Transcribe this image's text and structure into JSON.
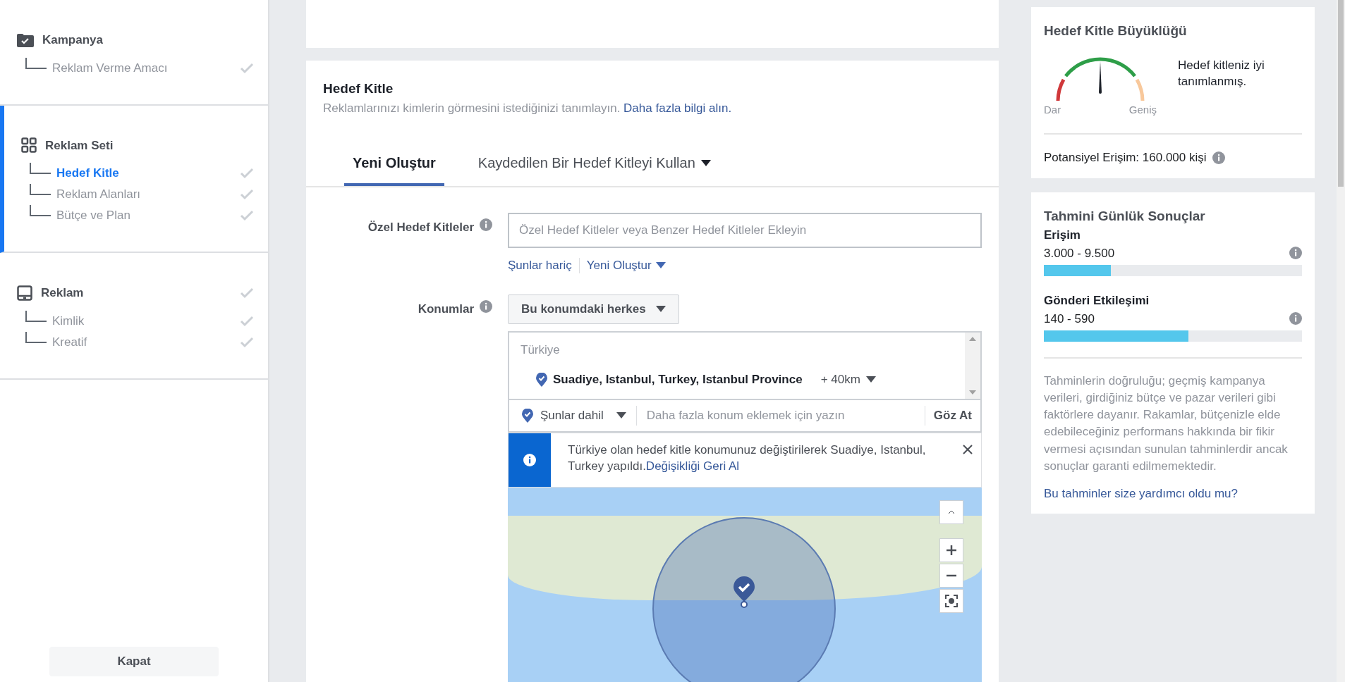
{
  "sidebar": {
    "sections": [
      {
        "title": "Kampanya",
        "active": false,
        "done": false,
        "items": [
          {
            "label": "Reklam Verme Amacı",
            "selected": false,
            "done": true
          }
        ]
      },
      {
        "title": "Reklam Seti",
        "active": true,
        "done": false,
        "items": [
          {
            "label": "Hedef Kitle",
            "selected": true,
            "done": true
          },
          {
            "label": "Reklam Alanları",
            "selected": false,
            "done": true
          },
          {
            "label": "Bütçe ve Plan",
            "selected": false,
            "done": true
          }
        ]
      },
      {
        "title": "Reklam",
        "active": false,
        "done": true,
        "items": [
          {
            "label": "Kimlik",
            "selected": false,
            "done": true
          },
          {
            "label": "Kreatif",
            "selected": false,
            "done": true
          }
        ]
      }
    ],
    "close_button": "Kapat"
  },
  "audience": {
    "title": "Hedef Kitle",
    "description": "Reklamlarınızı kimlerin görmesini istediğinizi tanımlayın.",
    "learn_more": "Daha fazla bilgi alın.",
    "tabs": [
      {
        "label": "Yeni Oluştur",
        "selected": true,
        "dropdown": false
      },
      {
        "label": "Kaydedilen Bir Hedef Kitleyi Kullan",
        "selected": false,
        "dropdown": true
      }
    ],
    "custom_audiences": {
      "label": "Özel Hedef Kitleler",
      "placeholder": "Özel Hedef Kitleler veya Benzer Hedef Kitleler Ekleyin",
      "exclude_link": "Şunlar hariç",
      "create_link": "Yeni Oluştur"
    },
    "locations": {
      "label": "Konumlar",
      "audience_dropdown": "Bu konumdaki herkes",
      "country": "Türkiye",
      "place": "Suadiye, Istanbul, Turkey, Istanbul Province",
      "radius": "+ 40km",
      "include_dropdown": "Şunlar dahil",
      "placeholder": "Daha fazla konum eklemek için yazın",
      "browse": "Göz At",
      "notice": {
        "text": "Türkiye olan hedef kitle konumunuz değiştirilerek Suadiye, Istanbul, Turkey yapıldı.",
        "undo": "Değişikliği Geri Al"
      }
    }
  },
  "audience_size": {
    "title": "Hedef Kitle Büyüklüğü",
    "level": 0.5,
    "min_label": "Dar",
    "max_label": "Geniş",
    "status": "Hedef kitleniz iyi tanımlanmış.",
    "potential_reach": "Potansiyel Erişim: 160.000 kişi"
  },
  "daily_results": {
    "title": "Tahmini Günlük Sonuçlar",
    "metrics": [
      {
        "name": "Erişim",
        "range": "3.000 - 9.500",
        "level": 0.26
      },
      {
        "name": "Gönderi Etkileşimi",
        "range": "140 - 590",
        "level": 0.56
      }
    ],
    "disclaimer": "Tahminlerin doğruluğu; geçmiş kampanya verileri, girdiğiniz bütçe ve pazar verileri gibi faktörlere dayanır. Rakamlar, bütçenizle elde edebileceğiniz performans hakkında bir fikir vermesi açısından sunulan tahminlerdir ancak sonuçlar garanti edilmemektedir.",
    "feedback_link": "Bu tahminler size yardımcı oldu mu?"
  }
}
